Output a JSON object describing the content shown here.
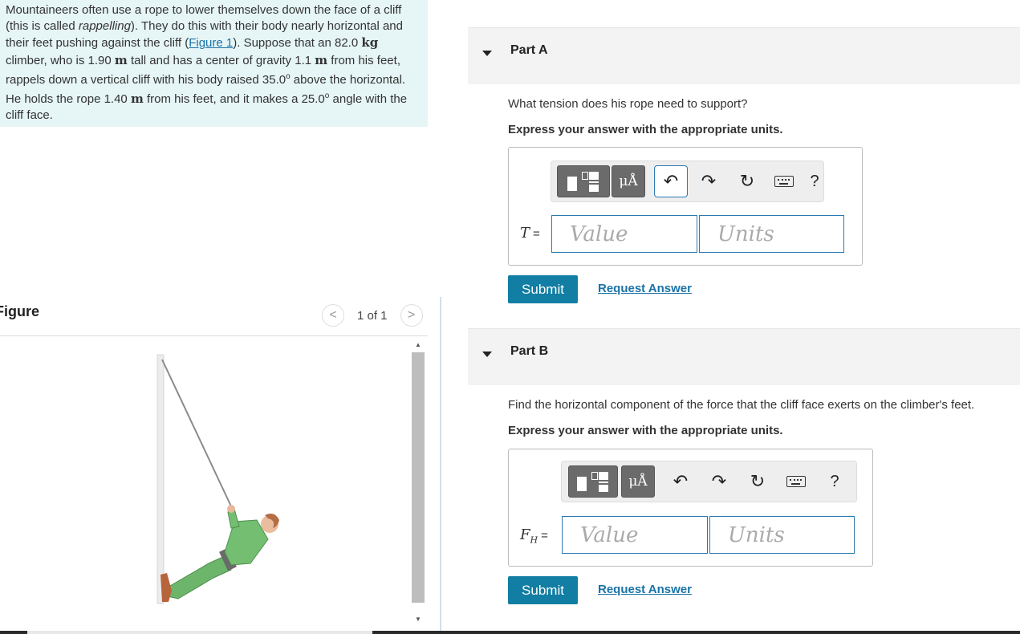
{
  "problem": {
    "t1": "Mountaineers often use a rope to lower themselves down the face of a cliff (this is called ",
    "t1_em": "rappelling",
    "t2": "). They do this with their body nearly horizontal and their feet pushing against the cliff (",
    "figure_link": "Figure 1",
    "t3": "). Suppose that an 82.0 ",
    "u_kg": "kg",
    "t4": " climber, who is 1.90 ",
    "u_m1": "m",
    "t5": " tall and has a center of gravity 1.1 ",
    "u_m2": "m",
    "t6": " from his feet, rappels down a vertical cliff with his body raised 35.0",
    "deg1": "o",
    "t7": " above the horizontal. He holds the rope 1.40 ",
    "u_m3": "m",
    "t8": " from his feet, and it makes a 25.0",
    "deg2": "o",
    "t9": " angle with the cliff face."
  },
  "figure": {
    "title": "Figure",
    "pager": "1 of 1",
    "prev": "<",
    "next": ">"
  },
  "toolbar": {
    "mu": "μÅ",
    "undo": "↶",
    "redo": "↷",
    "reset": "↻",
    "help": "?"
  },
  "partA": {
    "title": "Part A",
    "question": "What tension does his rope need to support?",
    "instruction": "Express your answer with the appropriate units.",
    "var": "T",
    "eq": "=",
    "value_placeholder": "Value",
    "units_placeholder": "Units",
    "submit": "Submit",
    "request": "Request Answer"
  },
  "partB": {
    "title": "Part B",
    "question": "Find the horizontal component of the force that the cliff face exerts on the climber's feet.",
    "instruction": "Express your answer with the appropriate units.",
    "var": "F",
    "var_sub": "H",
    "eq": "=",
    "value_placeholder": "Value",
    "units_placeholder": "Units",
    "submit": "Submit",
    "request": "Request Answer"
  }
}
